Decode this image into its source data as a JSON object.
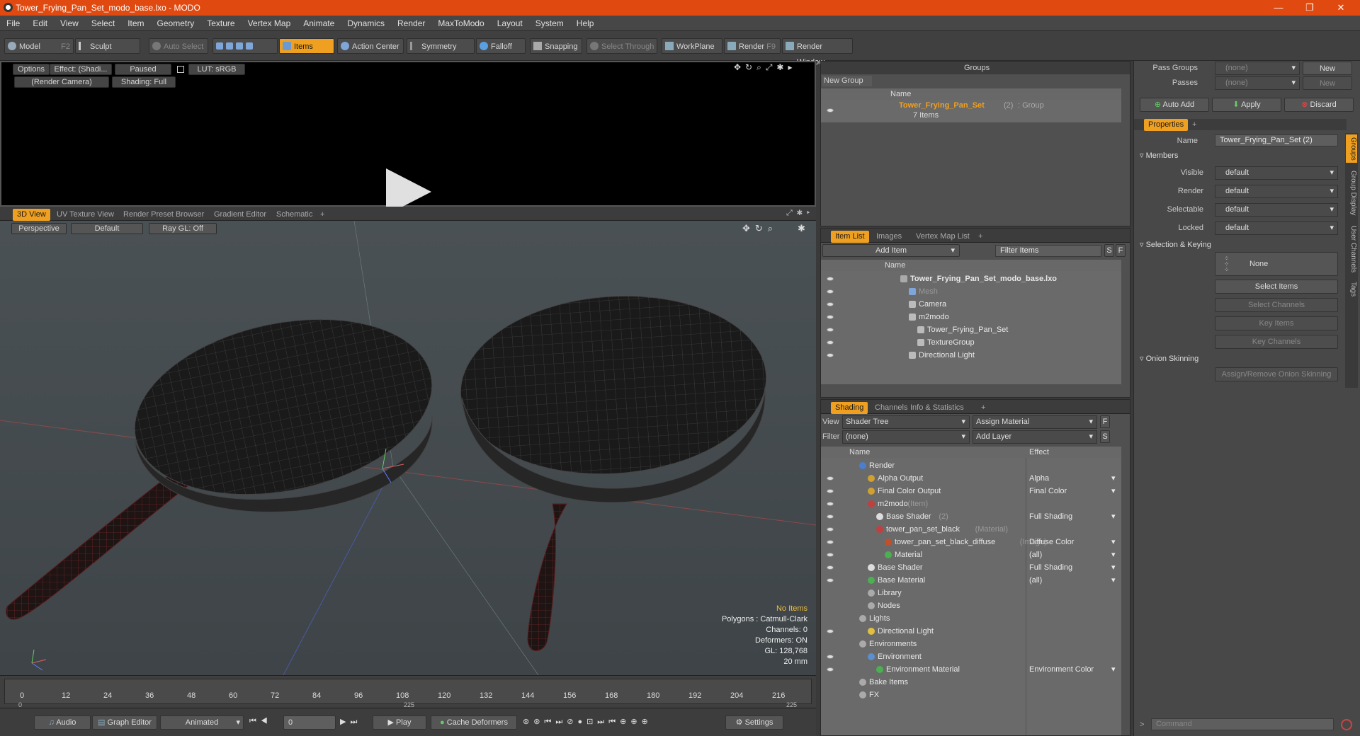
{
  "window": {
    "title": "Tower_Frying_Pan_Set_modo_base.lxo - MODO",
    "min": "—",
    "max": "❐",
    "close": "✕"
  },
  "menu": [
    "File",
    "Edit",
    "View",
    "Select",
    "Item",
    "Geometry",
    "Texture",
    "Vertex Map",
    "Animate",
    "Dynamics",
    "Render",
    "MaxToModo",
    "Layout",
    "System",
    "Help"
  ],
  "toolbar": {
    "model": "Model",
    "model_key": "F2",
    "sculpt": "Sculpt",
    "auto_select": "Auto Select",
    "items": "Items",
    "action_center": "Action Center",
    "symmetry": "Symmetry",
    "falloff": "Falloff",
    "snapping": "Snapping",
    "select_through": "Select Through",
    "workplane": "WorkPlane",
    "render": "Render",
    "render_key": "F9",
    "render_window": "Render Window"
  },
  "preview": {
    "options": "Options",
    "effect": "Effect: (Shadi...",
    "paused": "Paused",
    "lut": "LUT: sRGB",
    "camera": "(Render Camera)",
    "shading": "Shading: Full"
  },
  "viewport_tabs": [
    "3D View",
    "UV Texture View",
    "Render Preset Browser",
    "Gradient Editor",
    "Schematic",
    "+"
  ],
  "viewport": {
    "perspective": "Perspective",
    "default": "Default",
    "raygl": "Ray GL: Off",
    "status": [
      "No Items",
      "Polygons : Catmull-Clark",
      "Channels: 0",
      "Deformers: ON",
      "GL: 128,768",
      "20 mm"
    ]
  },
  "timeline": {
    "ticks": [
      "0",
      "12",
      "24",
      "36",
      "48",
      "60",
      "72",
      "84",
      "96",
      "108",
      "120",
      "132",
      "144",
      "156",
      "168",
      "180",
      "192",
      "204",
      "216"
    ],
    "sub_ticks": [
      "0",
      "225",
      "225"
    ]
  },
  "bottombar": {
    "audio": "Audio",
    "graph_editor": "Graph Editor",
    "animated": "Animated",
    "frame": "0",
    "play": "Play",
    "cache": "Cache Deformers",
    "settings": "Settings"
  },
  "groups": {
    "title": "Groups",
    "new_group": "New Group",
    "col_name": "Name",
    "item_name": "Tower_Frying_Pan_Set",
    "item_count": "(2)",
    "item_type": ": Group",
    "item_sub": "7 Items"
  },
  "itemlist": {
    "tabs": [
      "Item List",
      "Images",
      "Vertex Map List",
      "+"
    ],
    "add_item": "Add Item",
    "filter": "Filter Items",
    "col_name": "Name",
    "s": "S",
    "f": "F",
    "rows": [
      {
        "label": "Tower_Frying_Pan_Set_modo_base.lxo",
        "indent": 0
      },
      {
        "label": "Mesh",
        "indent": 1
      },
      {
        "label": "Camera",
        "indent": 1
      },
      {
        "label": "m2modo",
        "indent": 1
      },
      {
        "label": "Tower_Frying_Pan_Set",
        "indent": 2
      },
      {
        "label": "TextureGroup",
        "indent": 2
      },
      {
        "label": "Directional Light",
        "indent": 1
      }
    ]
  },
  "shading": {
    "tabs": [
      "Shading",
      "Channels",
      "Info & Statistics",
      "+"
    ],
    "view_label": "View",
    "view_value": "Shader Tree",
    "assign": "Assign Material",
    "filter_label": "Filter",
    "filter_value": "(none)",
    "add_layer": "Add Layer",
    "f": "F",
    "s": "S",
    "col_name": "Name",
    "col_effect": "Effect",
    "rows": [
      {
        "label": "Render",
        "sub": "",
        "effect": "",
        "indent": 0
      },
      {
        "label": "Alpha Output",
        "sub": "",
        "effect": "Alpha",
        "indent": 1
      },
      {
        "label": "Final Color Output",
        "sub": "",
        "effect": "Final Color",
        "indent": 1
      },
      {
        "label": "m2modo",
        "sub": "(Item)",
        "effect": "",
        "indent": 1
      },
      {
        "label": "Base Shader",
        "sub": "(2)",
        "effect": "Full Shading",
        "indent": 2
      },
      {
        "label": "tower_pan_set_black",
        "sub": "(Material)",
        "effect": "",
        "indent": 2
      },
      {
        "label": "tower_pan_set_black_diffuse",
        "sub": "(Image)",
        "effect": "Diffuse Color",
        "indent": 3
      },
      {
        "label": "Material",
        "sub": "",
        "effect": "(all)",
        "indent": 3
      },
      {
        "label": "Base Shader",
        "sub": "",
        "effect": "Full Shading",
        "indent": 1
      },
      {
        "label": "Base Material",
        "sub": "",
        "effect": "(all)",
        "indent": 1
      },
      {
        "label": "Library",
        "sub": "",
        "effect": "",
        "indent": 1
      },
      {
        "label": "Nodes",
        "sub": "",
        "effect": "",
        "indent": 1
      },
      {
        "label": "Lights",
        "sub": "",
        "effect": "",
        "indent": 0
      },
      {
        "label": "Directional Light",
        "sub": "",
        "effect": "",
        "indent": 1
      },
      {
        "label": "Environments",
        "sub": "",
        "effect": "",
        "indent": 0
      },
      {
        "label": "Environment",
        "sub": "",
        "effect": "",
        "indent": 1
      },
      {
        "label": "Environment Material",
        "sub": "",
        "effect": "Environment Color",
        "indent": 2
      },
      {
        "label": "Bake Items",
        "sub": "",
        "effect": "",
        "indent": 0
      },
      {
        "label": "FX",
        "sub": "",
        "effect": "",
        "indent": 0
      }
    ]
  },
  "props": {
    "pass_groups": "Pass Groups",
    "passes": "Passes",
    "none": "(none)",
    "new": "New",
    "auto_add": "Auto Add",
    "apply": "Apply",
    "discard": "Discard",
    "tab": "Properties",
    "plus": "+",
    "name_label": "Name",
    "name_value": "Tower_Frying_Pan_Set (2)",
    "members": "Members",
    "visible": "Visible",
    "render": "Render",
    "selectable": "Selectable",
    "locked": "Locked",
    "default": "default",
    "sel_keying": "Selection & Keying",
    "none_btn": "None",
    "select_items": "Select Items",
    "select_channels": "Select Channels",
    "key_items": "Key Items",
    "key_channels": "Key Channels",
    "onion": "Onion Skinning",
    "assign_onion": "Assign/Remove Onion Skinning",
    "command": "Command",
    "side_tabs": [
      "Groups",
      "Group Display",
      "User Channels",
      "Tags"
    ]
  }
}
